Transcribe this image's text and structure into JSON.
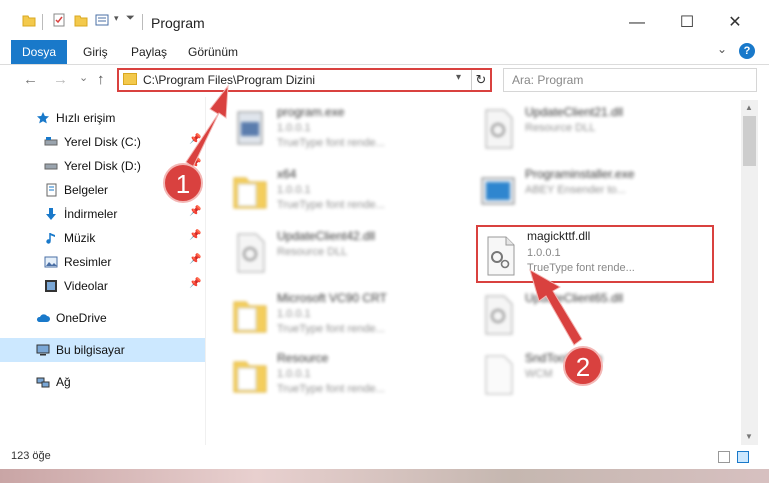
{
  "window": {
    "title": "Program",
    "minimize": "—",
    "maximize": "☐",
    "close": "✕"
  },
  "ribbon": {
    "tabs": [
      "Dosya",
      "Giriş",
      "Paylaş",
      "Görünüm"
    ],
    "help": "?"
  },
  "nav": {
    "back": "←",
    "forward": "→",
    "recent": "⌄",
    "up": "↑",
    "address": "C:\\Program Files\\Program Dizini",
    "refresh": "↻",
    "search_placeholder": "Ara: Program"
  },
  "sidebar": {
    "quick_access": "Hızlı erişim",
    "items": [
      {
        "label": "Yerel Disk (C:)",
        "icon": "drive-icon"
      },
      {
        "label": "Yerel Disk (D:)",
        "icon": "drive-icon"
      },
      {
        "label": "Belgeler",
        "icon": "documents-icon"
      },
      {
        "label": "İndirmeler",
        "icon": "downloads-icon"
      },
      {
        "label": "Müzik",
        "icon": "music-icon"
      },
      {
        "label": "Resimler",
        "icon": "pictures-icon"
      },
      {
        "label": "Videolar",
        "icon": "videos-icon"
      }
    ],
    "onedrive": "OneDrive",
    "this_pc": "Bu bilgisayar",
    "network": "Ağ"
  },
  "files": [
    {
      "name": "program.exe",
      "line1": "1.0.0.1",
      "line2": "TrueType font rende...",
      "icon": "exe-icon"
    },
    {
      "name": "UpdateClient21.dll",
      "line1": "Resource DLL",
      "line2": "",
      "icon": "dll-icon"
    },
    {
      "name": "x64",
      "line1": "1.0.0.1",
      "line2": "TrueType font rende...",
      "icon": "folder-icon"
    },
    {
      "name": "Programinstaller.exe",
      "line1": "ABEY Ensender to...",
      "line2": "",
      "icon": "installer-icon"
    },
    {
      "name": "UpdateClient42.dll",
      "line1": "Resource DLL",
      "line2": "",
      "icon": "dll-icon"
    },
    {
      "name": "magickttf.dll",
      "line1": "1.0.0.1",
      "line2": "TrueType font rende...",
      "icon": "dll-icon"
    },
    {
      "name": "Microsoft VC90 CRT",
      "line1": "1.0.0.1",
      "line2": "TrueType font rende...",
      "icon": "folder-icon"
    },
    {
      "name": "UpdateClient65.dll",
      "line1": "",
      "line2": "",
      "icon": "dll-icon"
    },
    {
      "name": "Resource",
      "line1": "1.0.0.1",
      "line2": "TrueType font rende...",
      "icon": "folder-icon"
    },
    {
      "name": "SndTools.wcm",
      "line1": "WCM",
      "line2": "",
      "icon": "file-icon"
    }
  ],
  "status": {
    "count": "123 öğe"
  },
  "annotations": {
    "step1": "1",
    "step2": "2"
  },
  "colors": {
    "accent": "#1979ca",
    "highlight": "#d9413f",
    "selection": "#cce8ff"
  }
}
